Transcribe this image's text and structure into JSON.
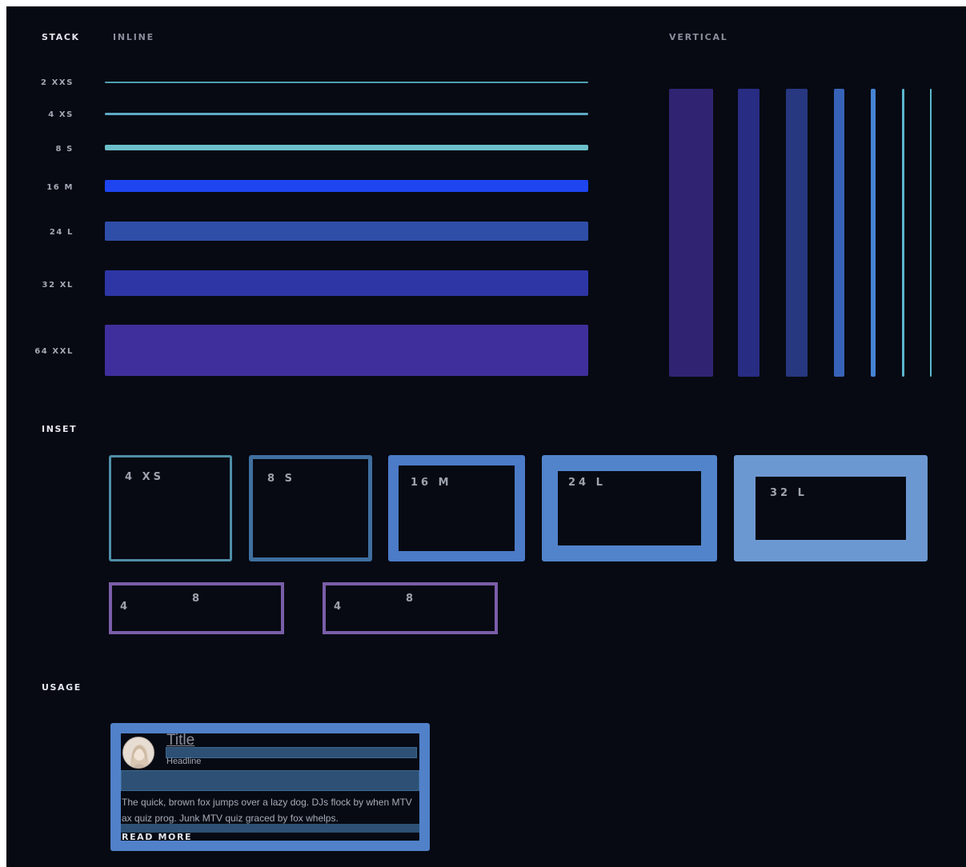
{
  "headings": {
    "stack": "STACK",
    "inline": "INLINE",
    "vertical": "VERTICAL",
    "inset": "INSET",
    "usage": "USAGE"
  },
  "stack": {
    "rows": [
      {
        "label": "2 XXS",
        "color": "#4fa0b1"
      },
      {
        "label": "4 XS",
        "color": "#5fa8c4"
      },
      {
        "label": "8 S",
        "color": "#6cbfca"
      },
      {
        "label": "16 M",
        "color": "#1e45f0"
      },
      {
        "label": "24 L",
        "color": "#2f4ea8"
      },
      {
        "label": "32 XL",
        "color": "#2e36a6"
      },
      {
        "label": "64 XXL",
        "color": "#3f2f9c"
      }
    ],
    "vertical_colors": [
      "#2a1f63",
      "#232672",
      "#22306f",
      "#2f56a0",
      "#3d72b8",
      "#4f9eb4",
      "#4fa0b1"
    ]
  },
  "inset": {
    "boxes": [
      {
        "label": "4 XS",
        "color": "#4f8ea8"
      },
      {
        "label": "8 S",
        "color": "#3f6fa0"
      },
      {
        "label": "16 M",
        "color": "#4c7bc7"
      },
      {
        "label": "24 L",
        "color": "#5284cb"
      },
      {
        "label": "32 L",
        "color": "#6c98d1"
      }
    ],
    "pairs": [
      {
        "left": "4",
        "top": "8"
      },
      {
        "left": "4",
        "top": "8"
      }
    ],
    "pair_color": "#7a5ea8"
  },
  "usage": {
    "title": "Title",
    "headline": "Headline",
    "body": "The quick, brown fox jumps over a lazy dog. DJs flock by when MTV ax quiz prog. Junk MTV quiz graced by fox whelps.",
    "link": "READ MORE",
    "frame_color": "#5181c9",
    "guide_color": "#2d5074"
  }
}
